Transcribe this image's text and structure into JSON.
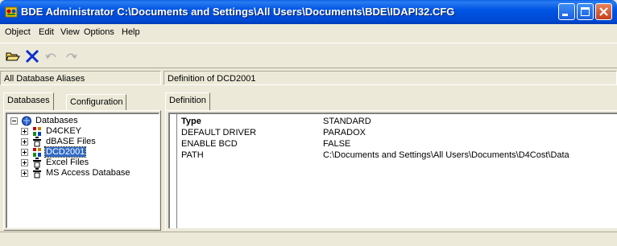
{
  "window": {
    "title": "BDE Administrator  C:\\Documents and Settings\\All Users\\Documents\\BDE\\IDAPI32.CFG",
    "app_icon": "bde-admin-icon",
    "controls": [
      "minimize-icon",
      "maximize-icon",
      "close-icon"
    ]
  },
  "menu": {
    "items": [
      {
        "label": "Object"
      },
      {
        "label": "Edit"
      },
      {
        "label": "View"
      },
      {
        "label": "Options"
      },
      {
        "label": "Help"
      }
    ]
  },
  "toolbar": {
    "buttons": [
      {
        "icon": "open-folder-icon",
        "enabled": true
      },
      {
        "icon": "delete-x-icon",
        "enabled": true
      },
      {
        "icon": "undo-icon",
        "enabled": false
      },
      {
        "icon": "redo-icon",
        "enabled": false
      }
    ]
  },
  "left_pane": {
    "header": "All Database Aliases",
    "tabs": [
      {
        "label": "Databases",
        "active": true
      },
      {
        "label": "Configuration",
        "active": false
      }
    ],
    "tree": {
      "root": {
        "label": "Databases",
        "icon": "databases-icon",
        "expanded": true
      },
      "items": [
        {
          "label": "D4CKEY",
          "icon": "database-alias-icon",
          "selected": false
        },
        {
          "label": "dBASE Files",
          "icon": "database-alias-icon",
          "selected": false
        },
        {
          "label": "DCD2001",
          "icon": "database-alias-icon",
          "selected": true
        },
        {
          "label": "Excel Files",
          "icon": "database-alias-icon",
          "selected": false
        },
        {
          "label": "MS Access Database",
          "icon": "database-alias-icon",
          "selected": false
        }
      ]
    }
  },
  "right_pane": {
    "header": "Definition of DCD2001",
    "tabs": [
      {
        "label": "Definition",
        "active": true
      }
    ],
    "rows": [
      {
        "key": "Type",
        "value": "STANDARD",
        "bold": true
      },
      {
        "key": "DEFAULT DRIVER",
        "value": "PARADOX",
        "bold": false
      },
      {
        "key": "ENABLE BCD",
        "value": "FALSE",
        "bold": false
      },
      {
        "key": "PATH",
        "value": "C:\\Documents and Settings\\All Users\\Documents\\D4Cost\\Data",
        "bold": false
      }
    ]
  },
  "colors": {
    "selection": "#316ac5",
    "title_blue": "#0055e5",
    "face": "#ece9d8"
  }
}
